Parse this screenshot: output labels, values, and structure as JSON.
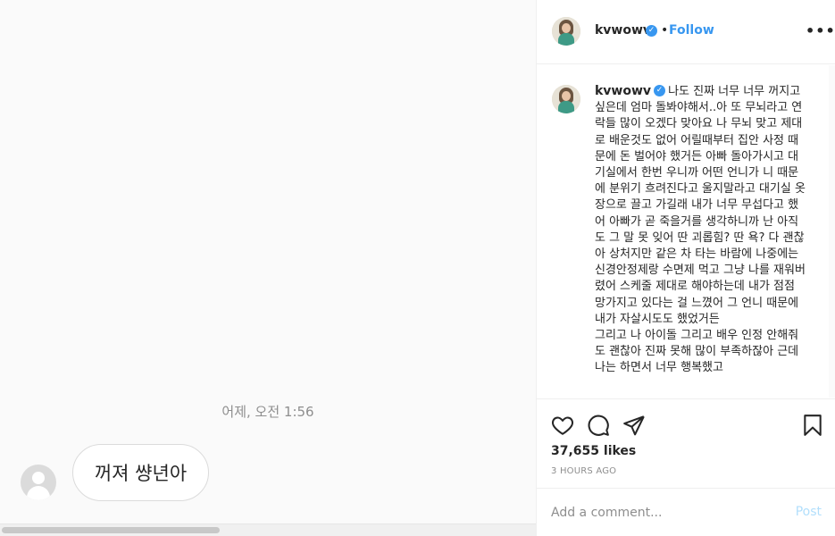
{
  "media": {
    "timestamp": "어제, 오전 1:56",
    "message": "꺼져 썅년아"
  },
  "post": {
    "username": "kvwowv",
    "dot": "•",
    "follow_label": "Follow",
    "more_label": "•••",
    "verified_glyph": "✓",
    "caption_text": "나도 진짜 너무 너무 꺼지고 싶은데 엄마 돌봐야해서..아 또 무뇌라고 연락들 많이 오겠다 맞아요 나 무뇌 맞고 제대로 배운것도 없어 어릴때부터 집안 사정 때문에 돈 벌어야 했거든 아빠 돌아가시고 대기실에서 한번 우니까 어떤 언니가 니 때문에 분위기 흐려진다고 울지말라고 대기실 옷장으로 끌고 가길래 내가 너무 무섭다고 했어 아빠가 곧 죽을거를 생각하니까 난 아직도 그 말 못 잊어 딴 괴롭힘? 딴 욕? 다 괜찮아 상처지만 같은 차 타는 바람에 나중에는 신경안정제랑 수면제 먹고 그냥 나를 재워버렸어 스케줄 제대로 해야하는데 내가 점점 망가지고 있다는 걸 느꼈어 그 언니 때문에 내가 자살시도도 했었거든\n그리고 나 아이돌 그리고 배우 인정 안해줘도 괜찮아 진짜 못해 많이 부족하잖아 근데 나는 하면서 너무 행복했고",
    "likes": "37,655 likes",
    "time": "3 HOURS AGO",
    "comment_placeholder": "Add a comment...",
    "post_label": "Post"
  },
  "colors": {
    "link_blue": "#3897f0",
    "post_disabled": "#b2dffc",
    "muted": "#8e8e8e",
    "text": "#262626"
  },
  "icons": [
    "heart-icon",
    "comment-icon",
    "share-icon",
    "bookmark-icon",
    "verified-icon",
    "more-icon",
    "default-avatar-icon"
  ]
}
